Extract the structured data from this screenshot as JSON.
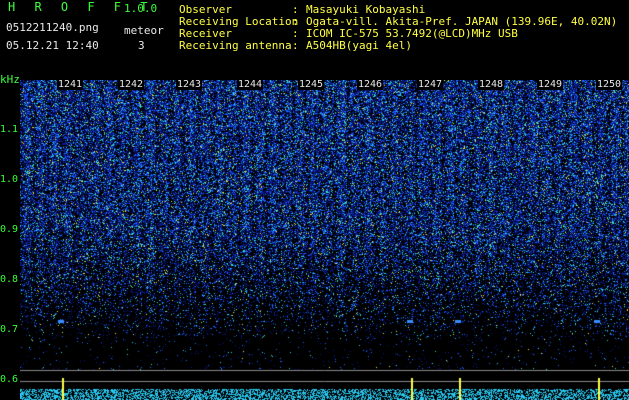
{
  "header": {
    "app_title": "H R O F F T",
    "app_version": "1.0.0",
    "file_name": "0512211240.png",
    "meteor_label": "meteor",
    "date_time": "05.12.21 12:40",
    "meteor_count": "3"
  },
  "station_info": [
    {
      "label": "Observer",
      "value": "Masayuki Kobayashi"
    },
    {
      "label": "Receiving Location",
      "value": "Ogata-vill. Akita-Pref. JAPAN (139.96E, 40.02N)"
    },
    {
      "label": "Receiver",
      "value": "ICOM IC-575 53.7492(@LCD)MHz USB"
    },
    {
      "label": "Receiving antenna",
      "value": "A504HB(yagi 4el)"
    }
  ],
  "separator": ":",
  "spectrogram": {
    "y_unit": "kHz",
    "y_ticks": [
      "1.1",
      "1.0",
      "0.9",
      "0.8",
      "0.7",
      "0.6"
    ],
    "y_range_khz": [
      0.55,
      1.2
    ],
    "minute_labels": [
      "1241",
      "1242",
      "1243",
      "1244",
      "1245",
      "1246",
      "1247",
      "1248",
      "1249",
      "1250"
    ],
    "meteor_echo_minutes": [
      1241.1,
      1246.9,
      1247.7,
      1250
    ],
    "colors": {
      "background": "#000000",
      "low": "#0a1a8c",
      "mid": "#1e6cff",
      "high": "#33e0c0",
      "peak": "#ffff44",
      "text_green": "#3cff3c"
    }
  }
}
